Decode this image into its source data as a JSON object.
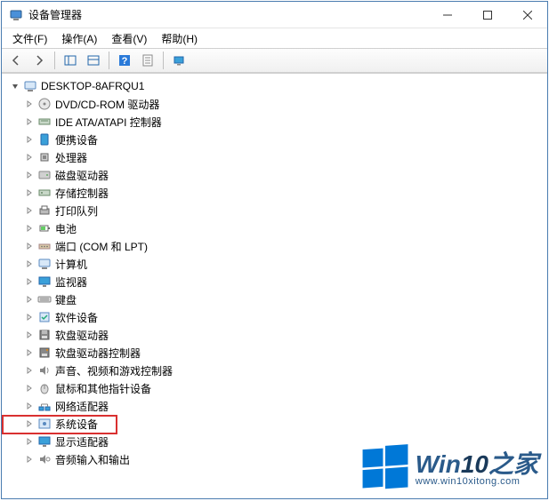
{
  "title": "设备管理器",
  "menu": {
    "file": "文件(F)",
    "action": "操作(A)",
    "view": "查看(V)",
    "help": "帮助(H)"
  },
  "toolbar_icons": {
    "back": "back-arrow-icon",
    "forward": "forward-arrow-icon",
    "show": "show-panel-icon",
    "help": "help-icon",
    "props": "properties-icon",
    "monitor": "monitor-icon"
  },
  "root": {
    "name": "DESKTOP-8AFRQU1",
    "icon": "computer-icon",
    "expanded": true
  },
  "categories": [
    {
      "label": "DVD/CD-ROM 驱动器",
      "icon": "disc-icon"
    },
    {
      "label": "IDE ATA/ATAPI 控制器",
      "icon": "ide-icon"
    },
    {
      "label": "便携设备",
      "icon": "portable-icon"
    },
    {
      "label": "处理器",
      "icon": "cpu-icon"
    },
    {
      "label": "磁盘驱动器",
      "icon": "disk-icon"
    },
    {
      "label": "存储控制器",
      "icon": "storage-icon"
    },
    {
      "label": "打印队列",
      "icon": "printer-icon"
    },
    {
      "label": "电池",
      "icon": "battery-icon"
    },
    {
      "label": "端口 (COM 和 LPT)",
      "icon": "port-icon"
    },
    {
      "label": "计算机",
      "icon": "computer-icon"
    },
    {
      "label": "监视器",
      "icon": "monitor-icon"
    },
    {
      "label": "键盘",
      "icon": "keyboard-icon"
    },
    {
      "label": "软件设备",
      "icon": "software-icon"
    },
    {
      "label": "软盘驱动器",
      "icon": "floppy-icon"
    },
    {
      "label": "软盘驱动器控制器",
      "icon": "floppy-ctrl-icon"
    },
    {
      "label": "声音、视频和游戏控制器",
      "icon": "sound-icon"
    },
    {
      "label": "鼠标和其他指针设备",
      "icon": "mouse-icon"
    },
    {
      "label": "网络适配器",
      "icon": "network-icon"
    },
    {
      "label": "系统设备",
      "icon": "system-icon",
      "highlighted": true
    },
    {
      "label": "显示适配器",
      "icon": "display-icon"
    },
    {
      "label": "音频输入和输出",
      "icon": "audio-icon"
    }
  ],
  "watermark": {
    "brand_prefix": "Win",
    "brand_num": "10",
    "brand_suffix": "之家",
    "url": "www.win10xitong.com"
  }
}
